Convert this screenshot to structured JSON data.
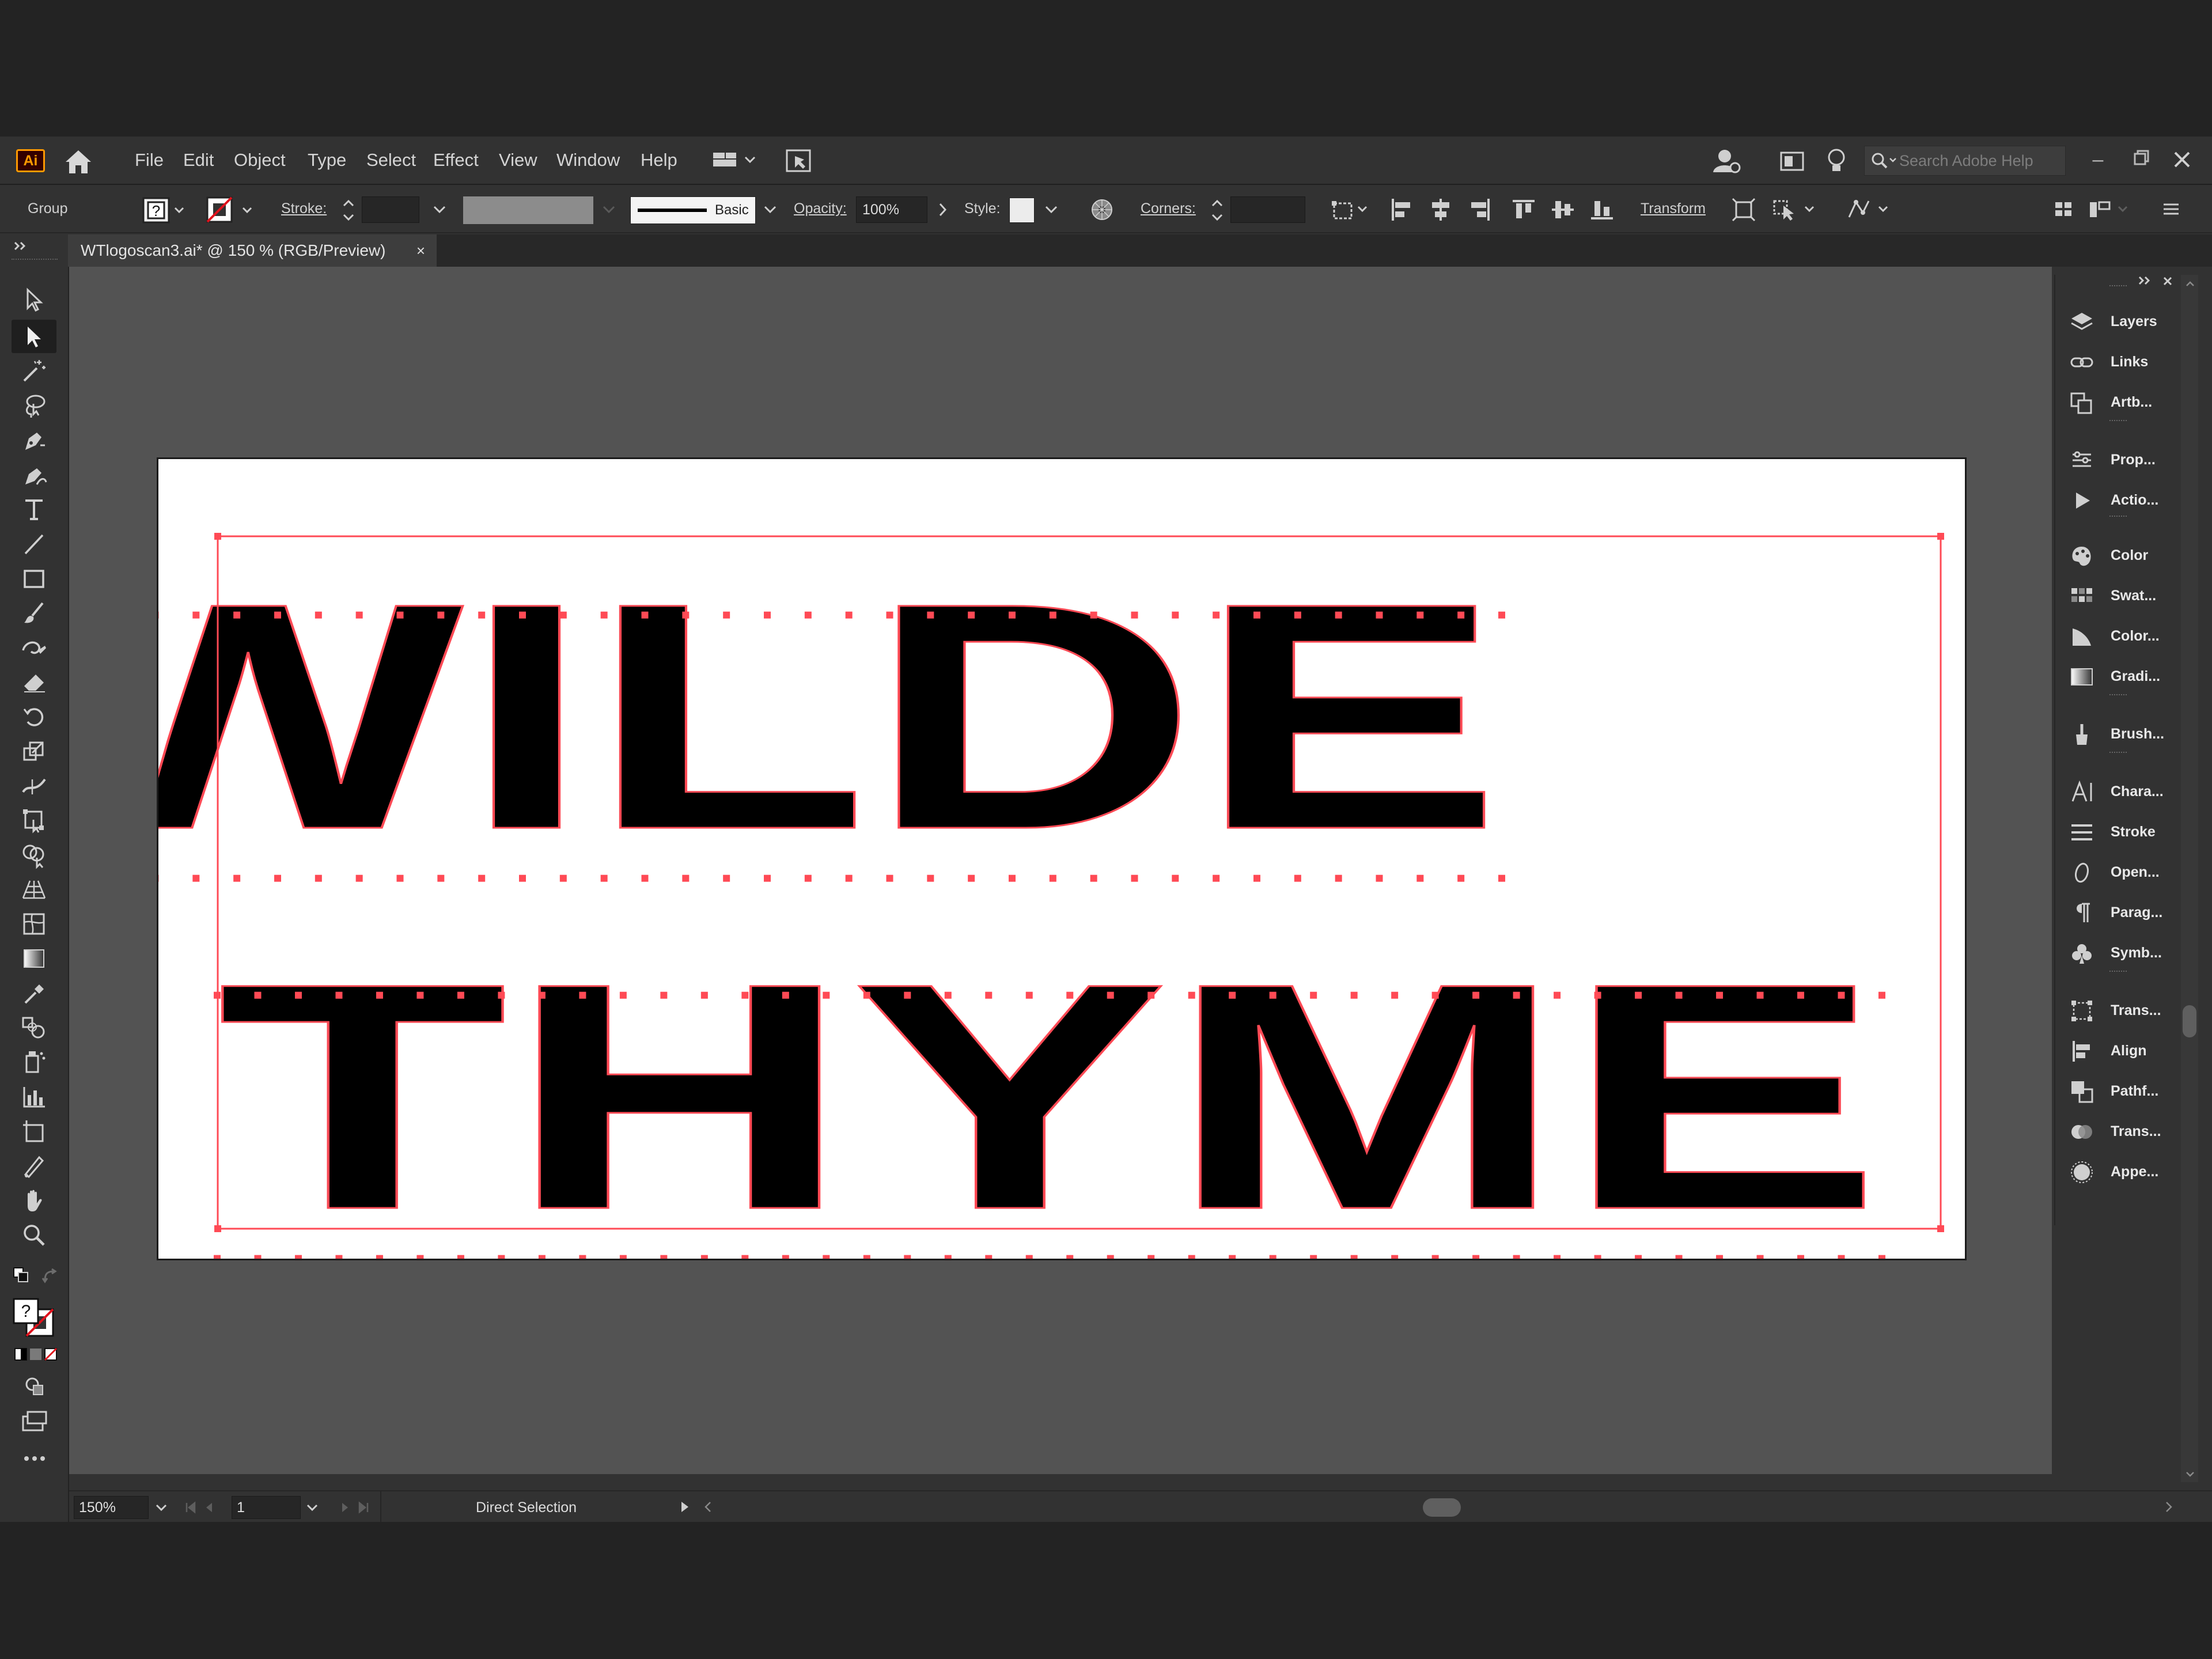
{
  "app": {
    "logo_text": "Ai",
    "brand_color": "#ff9a00"
  },
  "menu": {
    "items": [
      "File",
      "Edit",
      "Object",
      "Type",
      "Select",
      "Effect",
      "View",
      "Window",
      "Help"
    ],
    "search_placeholder": "Search Adobe Help"
  },
  "control_bar": {
    "selection_type": "Group",
    "stroke_label": "Stroke:",
    "stroke_style": "Basic",
    "opacity_label": "Opacity:",
    "opacity_value": "100%",
    "style_label": "Style:",
    "corners_label": "Corners:",
    "transform_label": "Transform"
  },
  "document": {
    "tab_title": "WTlogoscan3.ai* @ 150 % (RGB/Preview)",
    "close_glyph": "×"
  },
  "artwork": {
    "line1": "WILDE",
    "line2": "THYME",
    "selection_color": "#ff4a55"
  },
  "right_panel": {
    "groups": [
      [
        {
          "label": "Layers",
          "icon": "layers-icon"
        },
        {
          "label": "Links",
          "icon": "links-icon"
        },
        {
          "label": "Artb...",
          "icon": "artboards-icon"
        }
      ],
      [
        {
          "label": "Prop...",
          "icon": "properties-icon"
        },
        {
          "label": "Actio...",
          "icon": "actions-icon"
        }
      ],
      [
        {
          "label": "Color",
          "icon": "color-icon"
        },
        {
          "label": "Swat...",
          "icon": "swatches-icon"
        },
        {
          "label": "Color...",
          "icon": "color-guide-icon"
        },
        {
          "label": "Gradi...",
          "icon": "gradient-icon"
        }
      ],
      [
        {
          "label": "Brush...",
          "icon": "brushes-icon"
        }
      ],
      [
        {
          "label": "Chara...",
          "icon": "character-icon"
        },
        {
          "label": "Stroke",
          "icon": "stroke-icon"
        },
        {
          "label": "Open...",
          "icon": "opentype-icon"
        },
        {
          "label": "Parag...",
          "icon": "paragraph-icon"
        },
        {
          "label": "Symb...",
          "icon": "symbols-icon"
        }
      ],
      [
        {
          "label": "Trans...",
          "icon": "transform-icon"
        },
        {
          "label": "Align",
          "icon": "align-icon"
        },
        {
          "label": "Pathf...",
          "icon": "pathfinder-icon"
        },
        {
          "label": "Trans...",
          "icon": "transparency-icon"
        },
        {
          "label": "Appe...",
          "icon": "appearance-icon"
        }
      ]
    ]
  },
  "status_bar": {
    "zoom": "150%",
    "artboard_number": "1",
    "tool_name": "Direct Selection"
  },
  "colors": {
    "app_bg": "#323232",
    "canvas_bg": "#535353",
    "artboard_bg": "#ffffff",
    "glyph_fill": "#000000"
  }
}
